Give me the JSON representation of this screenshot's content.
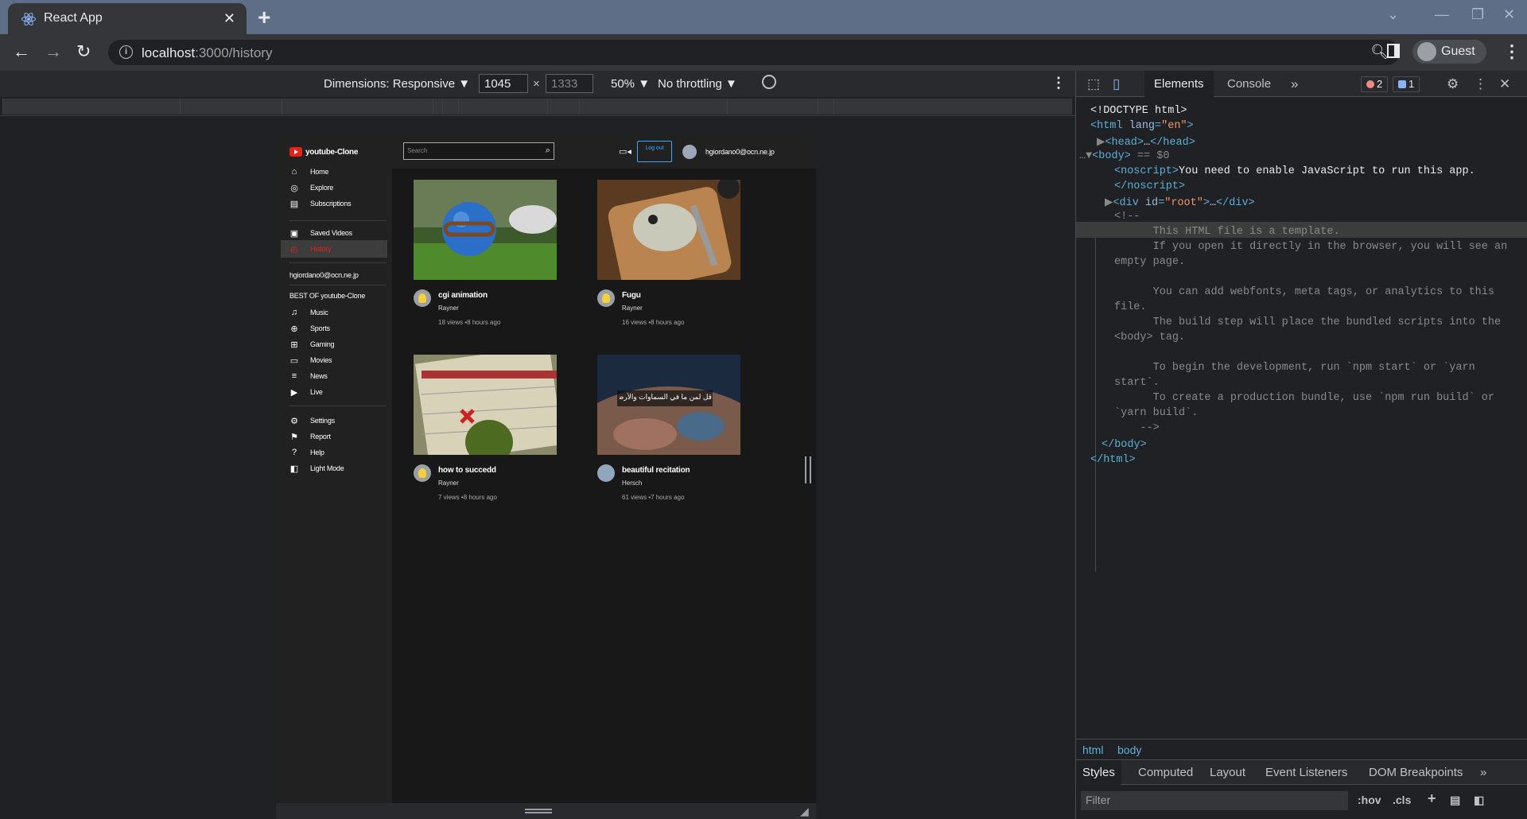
{
  "browser": {
    "tab_title": "React App",
    "tab_close": "✕",
    "new_tab": "+",
    "url_host": "localhost",
    "url_path": ":3000/history",
    "profile_name": "Guest",
    "window_controls": [
      "⌄",
      "—",
      "❐",
      "✕"
    ]
  },
  "device_toolbar": {
    "dimensions": "Dimensions: Responsive ▼",
    "width": "1045",
    "times": "×",
    "height_placeholder": "1333",
    "zoom": "50% ▼",
    "throttling": "No throttling ▼",
    "more": "⋮"
  },
  "app": {
    "brand": "youtube-Clone",
    "nav_primary": [
      {
        "label": "Home",
        "icon": "home-icon",
        "glyph": "⌂"
      },
      {
        "label": "Explore",
        "icon": "explore-icon",
        "glyph": "◎"
      },
      {
        "label": "Subscriptions",
        "icon": "subscriptions-icon",
        "glyph": "▤"
      }
    ],
    "nav_library": [
      {
        "label": "Saved Videos",
        "icon": "saved-videos-icon",
        "glyph": "▣"
      },
      {
        "label": "History",
        "icon": "history-icon",
        "glyph": "◴",
        "active": true
      }
    ],
    "user_email": "hgiordano0@ocn.ne.jp",
    "best_of": "BEST OF youtube-Clone",
    "nav_categories": [
      {
        "label": "Music",
        "icon": "music-icon",
        "glyph": "♫"
      },
      {
        "label": "Sports",
        "icon": "sports-icon",
        "glyph": "⊕"
      },
      {
        "label": "Gaming",
        "icon": "gaming-icon",
        "glyph": "⊞"
      },
      {
        "label": "Movies",
        "icon": "movies-icon",
        "glyph": "▭"
      },
      {
        "label": "News",
        "icon": "news-icon",
        "glyph": "≡"
      },
      {
        "label": "Live",
        "icon": "live-icon",
        "glyph": "▶"
      }
    ],
    "nav_settings": [
      {
        "label": "Settings",
        "icon": "settings-icon",
        "glyph": "⚙"
      },
      {
        "label": "Report",
        "icon": "report-icon",
        "glyph": "⚑"
      },
      {
        "label": "Help",
        "icon": "help-icon",
        "glyph": "?"
      },
      {
        "label": "Light Mode",
        "icon": "light-mode-icon",
        "glyph": "◧"
      }
    ],
    "search_placeholder": "Search",
    "logout_label": "Log out",
    "header_email": "hgiordano0@ocn.ne.jp",
    "videos": [
      {
        "title": "cgi animation",
        "channel": "Rayner",
        "stats": "18 views •8 hours ago"
      },
      {
        "title": "Fugu",
        "channel": "Rayner",
        "stats": "16 views •8 hours ago"
      },
      {
        "title": "how to succedd",
        "channel": "Rayner",
        "stats": "7 views •8 hours ago"
      },
      {
        "title": "beautiful recitation",
        "channel": "Hersch",
        "stats": "61 views •7 hours ago"
      }
    ],
    "thumbnail_overlay_text": "قل لمن ما في السماوات والأرض قل لله"
  },
  "devtools": {
    "tabs": [
      "Elements",
      "Console"
    ],
    "more_tabs": "»",
    "errors": "2",
    "messages": "1",
    "dom_lines": {
      "doctype": "<!DOCTYPE html>",
      "noscript_text": "You need to enable JavaScript to run this app.",
      "body_marker": "== $0",
      "comment": [
        "<!--",
        "      This HTML file is a template.",
        "      If you open it directly in the browser, you will see an",
        "empty page.",
        "",
        "      You can add webfonts, meta tags, or analytics to this",
        "file.",
        "      The build step will place the bundled scripts into the",
        "<body> tag.",
        "",
        "      To begin the development, run `npm start` or `yarn",
        "start`.",
        "      To create a production bundle, use `npm run build` or",
        "`yarn build`.",
        "    -->"
      ]
    },
    "breadcrumbs": [
      "html",
      "body"
    ],
    "style_tabs": [
      "Styles",
      "Computed",
      "Layout",
      "Event Listeners",
      "DOM Breakpoints"
    ],
    "filter_placeholder": "Filter",
    "hov": ":hov",
    "cls": ".cls"
  }
}
